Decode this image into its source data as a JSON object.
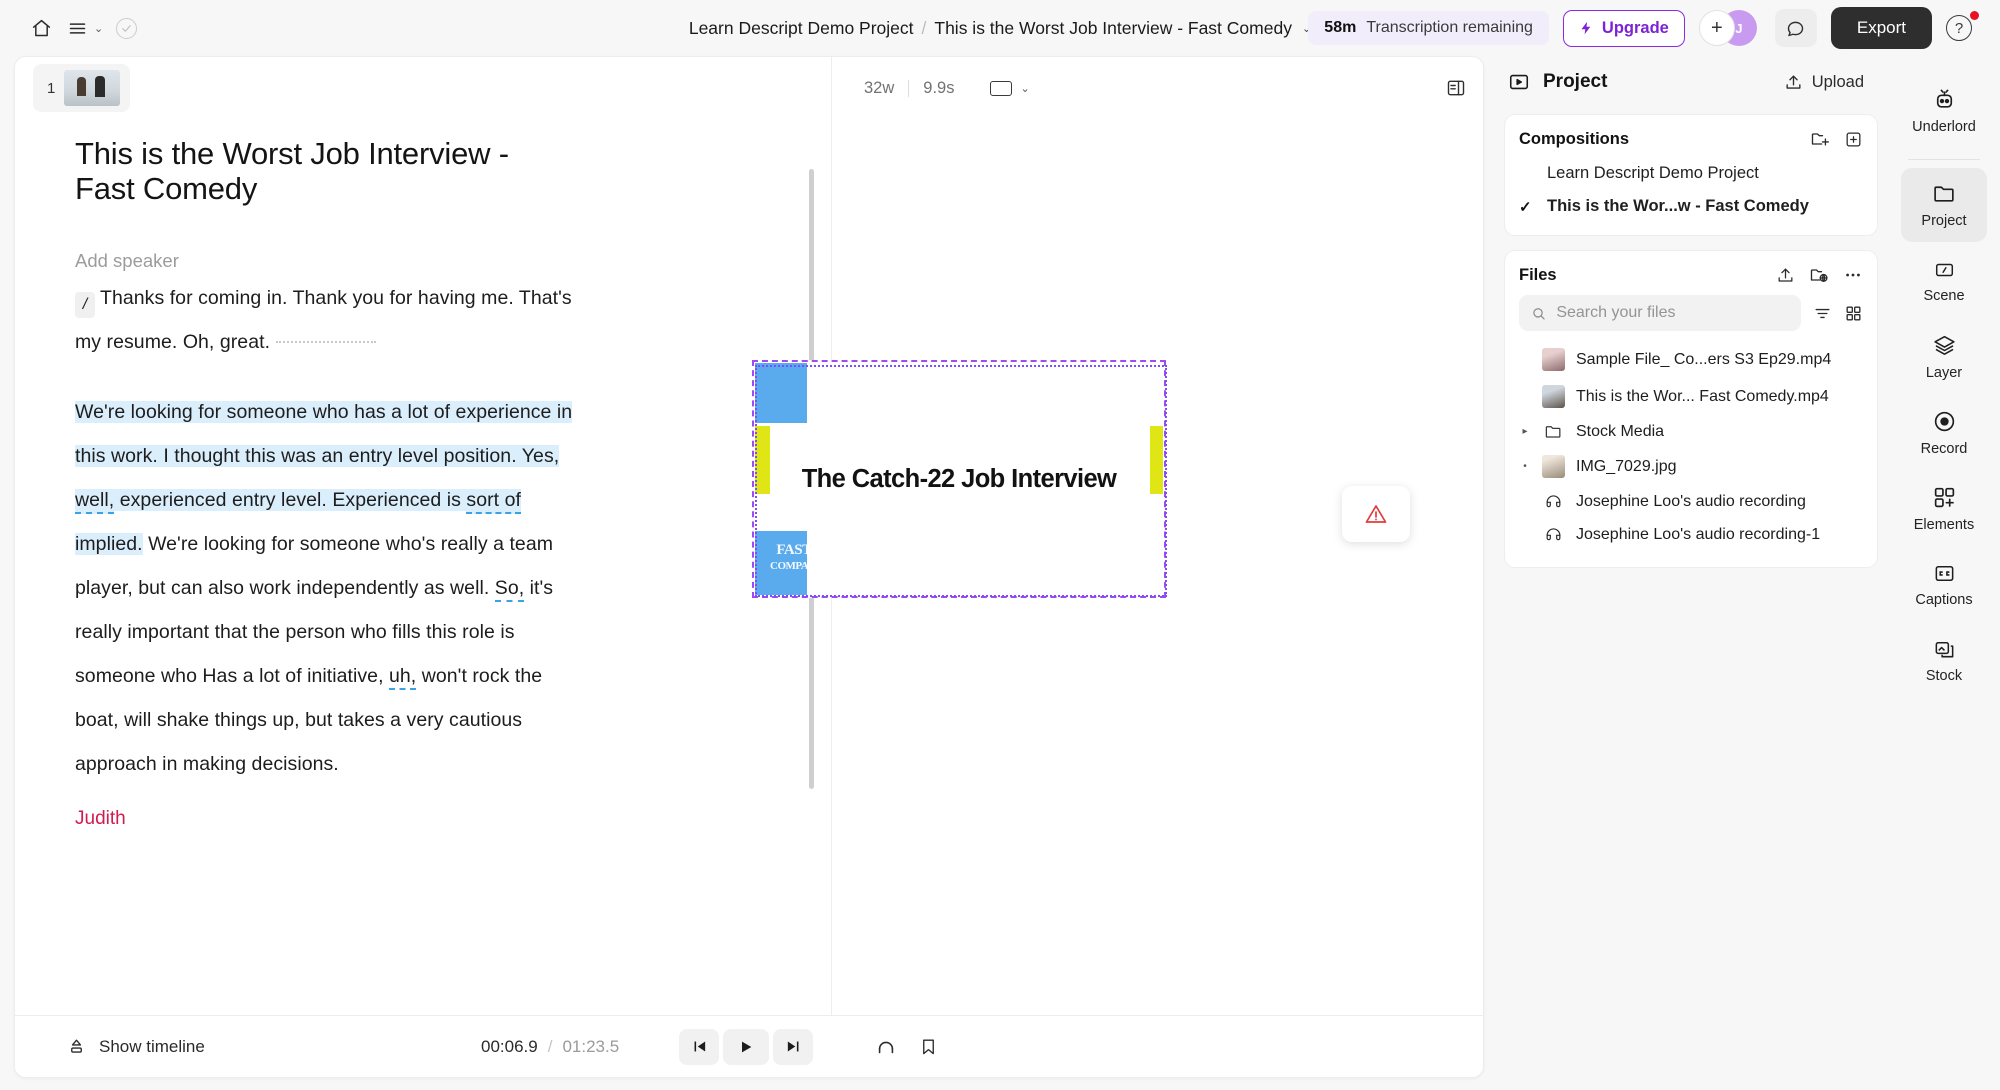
{
  "topbar": {
    "home_icon": "home-icon",
    "menu_icon": "hamburger-icon",
    "menu_chevron": "⌄",
    "status_icon": "check-circle-icon",
    "breadcrumb_project": "Learn Descript Demo Project",
    "breadcrumb_sep": "/",
    "breadcrumb_current": "This is the Worst Job Interview - Fast Comedy",
    "breadcrumb_chevron": "⌄",
    "transcription_minutes": "58m",
    "transcription_label": "Transcription remaining",
    "upgrade_label": "Upgrade",
    "upgrade_icon": "lightning-bolt-icon",
    "avatar_add": "+",
    "avatar_initial": "J",
    "comment_icon": "comment-bubble-icon",
    "export_label": "Export",
    "help_label": "?",
    "accent_purple": "#7c23d6",
    "export_bg": "#2e2e2e"
  },
  "script": {
    "scene_number": "1",
    "doc_title": "This is the Worst Job Interview - Fast Comedy",
    "add_speaker": "Add speaker",
    "slash_chip": "/",
    "paragraph1_a": "Thanks for coming in. Thank you for having",
    "paragraph1_b": "me. That's my resume. Oh, great.",
    "p2_seg1": "We're looking for someone who has a lot of experience in this work. I thought this was an entry level position. Yes, ",
    "p2_filler1": "well,",
    "p2_seg2": " experienced entry level. Experienced is ",
    "p2_filler2": "sort of",
    "p2_seg3": " implied. We're looking for someone who's really a team player, but can also work independently as well. ",
    "p2_filler3": "So,",
    "p2_seg4": " it's really important that the person who fills this role is someone who Has a lot of initiative, ",
    "p2_filler4": "uh,",
    "p2_seg5": " won't rock the boat, will shake things up, but takes a very cautious approach in making decisions.",
    "speaker_judith": "Judith",
    "highlight_color": "#dbeefc",
    "filler_underline_color": "#3aa3e8",
    "speaker_color": "#d11a52"
  },
  "canvas": {
    "words_count": "32w",
    "duration": "9.9s",
    "ratio_icon": "aspect-ratio-icon",
    "ratio_chevron": "⌄",
    "panel_toggle_icon": "panel-layout-icon",
    "comp_title": "The Catch-22 Job Interview",
    "brand_line1": "FAST",
    "brand_line2": "COMPANY",
    "warning_icon": "warning-triangle-icon",
    "selection_color": "#7c4dff",
    "blue": "#5aabee",
    "yellow": "#e0e616"
  },
  "playbar": {
    "show_timeline_icon": "timeline-expand-icon",
    "show_timeline_label": "Show timeline",
    "current_time": "00:06.9",
    "time_separator": "/",
    "total_time": "01:23.5",
    "prev_icon": "skip-previous-icon",
    "play_icon": "play-icon",
    "next_icon": "skip-next-icon",
    "loop_icon": "loop-icon",
    "bookmark_icon": "bookmark-icon"
  },
  "project_panel": {
    "panel_icon": "project-video-icon",
    "title": "Project",
    "upload_icon": "upload-icon",
    "upload_label": "Upload",
    "compositions": {
      "title": "Compositions",
      "new_folder_icon": "new-folder-icon",
      "add_icon": "plus-square-icon",
      "items": [
        {
          "label": "Learn Descript Demo Project",
          "selected": false
        },
        {
          "label": "This is the Wor...w - Fast Comedy",
          "selected": true
        }
      ],
      "check_glyph": "✓"
    },
    "files": {
      "title": "Files",
      "upload_icon": "upload-icon",
      "stock_folder_icon": "folder-globe-icon",
      "more_icon": "more-horizontal-icon",
      "search_placeholder": "Search your files",
      "search_value": "",
      "search_icon": "search-icon",
      "sort_icon": "sort-filter-icon",
      "grid_icon": "grid-view-icon",
      "items": [
        {
          "label": "Sample File_ Co...ers S3 Ep29.mp4",
          "kind": "video",
          "expandable": false,
          "marker": ""
        },
        {
          "label": "This is the Wor... Fast Comedy.mp4",
          "kind": "video",
          "expandable": false,
          "marker": ""
        },
        {
          "label": "Stock Media",
          "kind": "folder",
          "expandable": true,
          "marker": "▸"
        },
        {
          "label": "IMG_7029.jpg",
          "kind": "image",
          "expandable": false,
          "marker": "•"
        },
        {
          "label": "Josephine Loo's audio recording",
          "kind": "audio",
          "expandable": false,
          "marker": ""
        },
        {
          "label": "Josephine Loo's audio recording-1",
          "kind": "audio",
          "expandable": false,
          "marker": ""
        }
      ]
    }
  },
  "rail": {
    "items": [
      {
        "label": "Underlord",
        "icon": "robot-icon",
        "active": false
      },
      {
        "label": "Project",
        "icon": "folder-icon",
        "active": true
      },
      {
        "label": "Scene",
        "icon": "scene-slash-icon",
        "active": false
      },
      {
        "label": "Layer",
        "icon": "layers-icon",
        "active": false
      },
      {
        "label": "Record",
        "icon": "record-circle-icon",
        "active": false
      },
      {
        "label": "Elements",
        "icon": "elements-grid-icon",
        "active": false
      },
      {
        "label": "Captions",
        "icon": "captions-icon",
        "active": false
      },
      {
        "label": "Stock",
        "icon": "stock-media-icon",
        "active": false
      }
    ]
  }
}
